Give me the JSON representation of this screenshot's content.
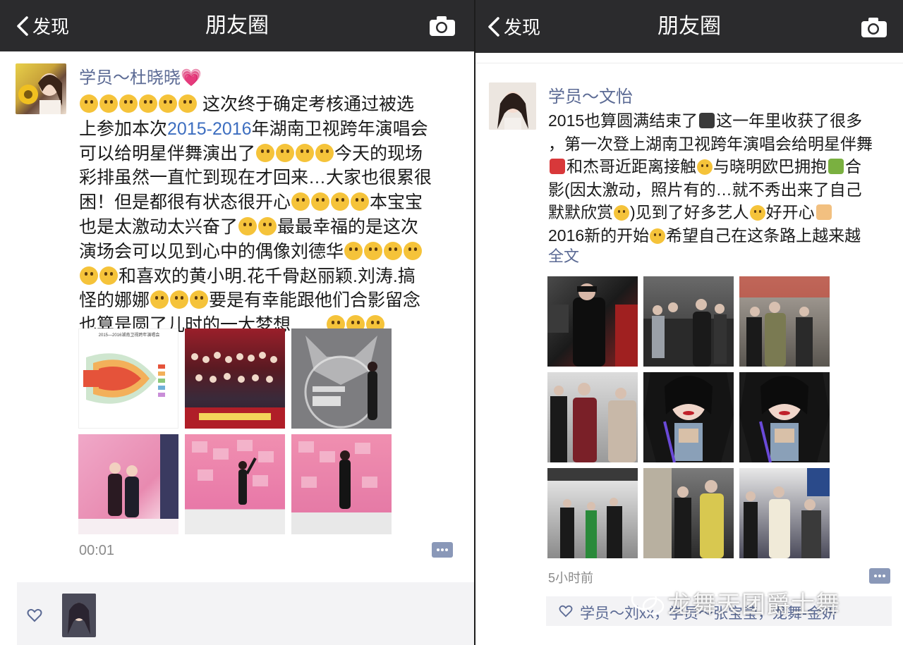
{
  "left": {
    "nav": {
      "back_label": "发现",
      "title": "朋友圈"
    },
    "post": {
      "author": "学员～杜晓晓💗",
      "lines": [
        [
          "E",
          "E",
          "E",
          "E",
          "E",
          "E",
          " 这次终于确定考核通过被选"
        ],
        [
          "上参加本次",
          "H:2015-2016",
          "年湖南卫视跨年演唱会"
        ],
        [
          " 可以给明星伴舞演出了",
          "E",
          "E",
          "E",
          "E",
          "今天的现场"
        ],
        [
          "彩排虽然一直忙到现在才回来…大家也很累很"
        ],
        [
          "困！但是都很有状态很开心",
          "E",
          "E",
          "E",
          "E",
          "本宝宝"
        ],
        [
          "也是太激动太兴奋了",
          "E",
          "E",
          "最最幸福的是这次"
        ],
        [
          "演场会可以见到心中的偶像刘德华",
          "E",
          "E",
          "E",
          "E"
        ],
        [
          "E",
          "E",
          "和喜欢的黄小明.花千骨赵丽颖.刘涛.搞"
        ],
        [
          "怪的娜娜",
          "E",
          "E",
          "E",
          "要是有幸能跟他们合影留念"
        ],
        [
          "也算是圆了儿时的一大梦想……",
          "E",
          "E",
          "E"
        ]
      ],
      "seat_chart_header": "2015—2016湖南卫视跨年演唱会",
      "timestamp": "00:01"
    },
    "likes": {
      "icon": "heart-outline-icon"
    }
  },
  "right": {
    "nav": {
      "back_label": "发现",
      "title": "朋友圈"
    },
    "post": {
      "author": "学员～文怡",
      "lines": [
        [
          "2015也算圆满结束了",
          "G:end",
          "这一年里收获了很多"
        ],
        [
          "，第一次登上湖南卫视跨年演唱会给明星伴舞"
        ],
        [
          "G:dancer",
          "和杰哥近距离接触",
          "E",
          "与晓明欧巴拥抱",
          "G:hug",
          "合"
        ],
        [
          "影(因太激动，照片有的…就不秀出来了自己"
        ],
        [
          "默默欣赏",
          "E",
          ")见到了好多艺人",
          "E",
          "好开心",
          "G:victory"
        ],
        [
          "2016新的开始",
          "E",
          "希望自己在这条路上越来越"
        ]
      ],
      "full_text_link": "全文",
      "timestamp": "5小时前"
    },
    "likes": {
      "text": "学员～刘xx，学员～张宝莹，龙舞-金妍"
    },
    "watermark": "龙舞天团爵士舞"
  },
  "colors": {
    "nav_bar": "#2b2b2d",
    "name_link": "#5b6a94",
    "highlight_link": "#3d6ec0",
    "comment_button": "#8a98b8",
    "likes_background": "#f3f3f5"
  }
}
